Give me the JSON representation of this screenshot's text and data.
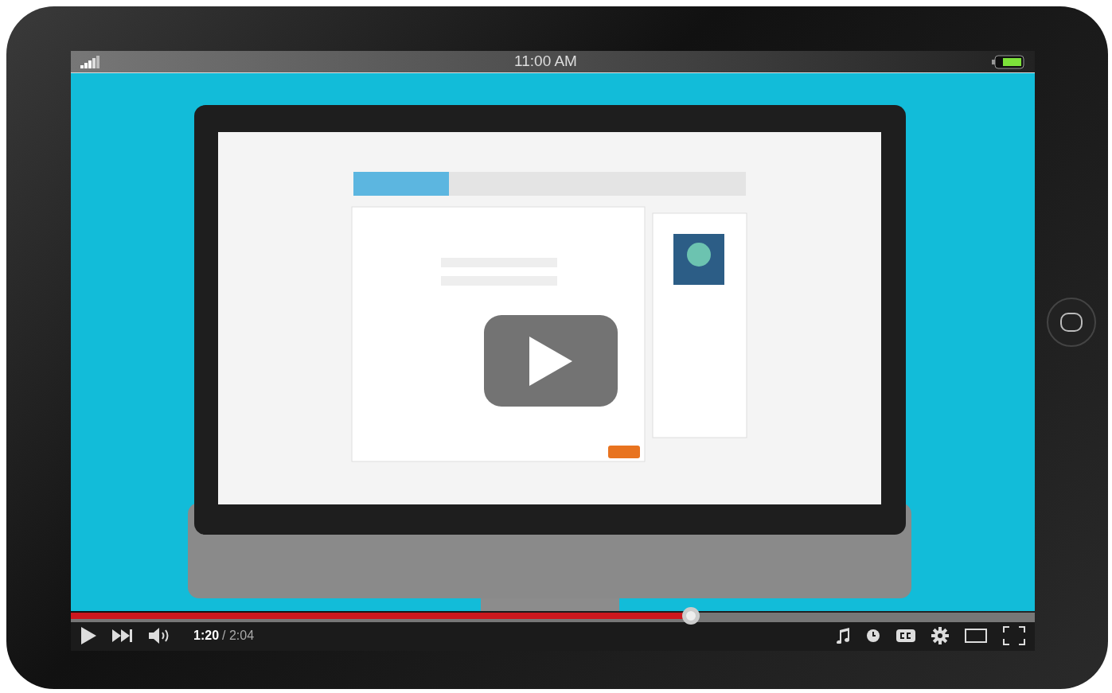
{
  "status_bar": {
    "time": "11:00 AM"
  },
  "player": {
    "playing": false,
    "progress": {
      "level": 0.643
    },
    "time": {
      "current": "1:20",
      "duration": "/ 2:04"
    }
  }
}
